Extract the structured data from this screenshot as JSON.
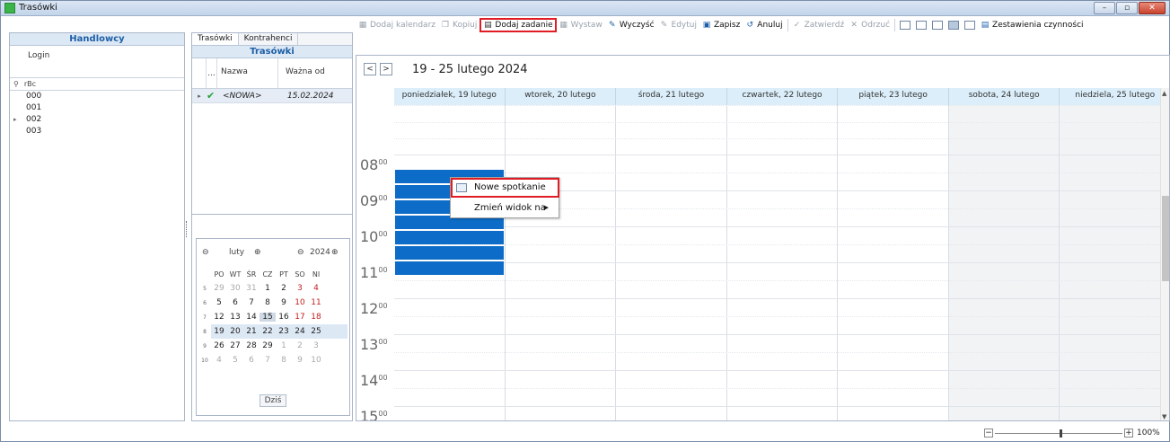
{
  "window": {
    "title": "Trasówki"
  },
  "left_panel": {
    "header": "Handlowcy",
    "column": "Login",
    "filter_icon": "rBc",
    "rows": [
      "000",
      "001",
      "002",
      "003"
    ]
  },
  "middle_panel": {
    "tabs": [
      "Trasówki",
      "Kontrahenci"
    ],
    "header": "Trasówki",
    "col_dots": "...",
    "col_name": "Nazwa",
    "col_date": "Ważna od",
    "row": {
      "name": "<NOWA>",
      "date": "15.02.2024"
    }
  },
  "mini_calendar": {
    "month": "luty",
    "year": "2024",
    "weekdays": [
      "PO",
      "WT",
      "ŚR",
      "CZ",
      "PT",
      "SO",
      "NI"
    ],
    "weeks": [
      {
        "n": "5",
        "days": [
          "29",
          "30",
          "31",
          "1",
          "2",
          "3",
          "4"
        ]
      },
      {
        "n": "6",
        "days": [
          "5",
          "6",
          "7",
          "8",
          "9",
          "10",
          "11"
        ]
      },
      {
        "n": "7",
        "days": [
          "12",
          "13",
          "14",
          "15",
          "16",
          "17",
          "18"
        ]
      },
      {
        "n": "8",
        "days": [
          "19",
          "20",
          "21",
          "22",
          "23",
          "24",
          "25"
        ]
      },
      {
        "n": "9",
        "days": [
          "26",
          "27",
          "28",
          "29",
          "1",
          "2",
          "3"
        ]
      },
      {
        "n": "10",
        "days": [
          "4",
          "5",
          "6",
          "7",
          "8",
          "9",
          "10"
        ]
      }
    ],
    "today_button": "Dziś"
  },
  "toolbar": {
    "add_calendar": "Dodaj kalendarz",
    "copy": "Kopiuj",
    "add_task": "Dodaj zadanie",
    "issue": "Wystaw",
    "clear": "Wyczyść",
    "edit": "Edytuj",
    "save": "Zapisz",
    "cancel": "Anuluj",
    "approve": "Zatwierdź",
    "reject": "Odrzuć",
    "reports": "Zestawienia czynności"
  },
  "calendar": {
    "range": "19 - 25 lutego 2024",
    "days": [
      "poniedziałek, 19 lutego",
      "wtorek, 20 lutego",
      "środa, 21 lutego",
      "czwartek, 22 lutego",
      "piątek, 23 lutego",
      "sobota, 24 lutego",
      "niedziela, 25 lutego"
    ],
    "hours": [
      "08",
      "09",
      "10",
      "11",
      "12",
      "13",
      "14",
      "15"
    ],
    "minutes": "00"
  },
  "context_menu": {
    "new_meeting": "Nowe spotkanie",
    "change_view": "Zmień widok na"
  },
  "zoom": {
    "value": "100%",
    "minus": "−",
    "plus": "+"
  },
  "colors": {
    "accent": "#1d5fa7",
    "selection": "#0c6cc7",
    "highlight": "#e01c24"
  }
}
